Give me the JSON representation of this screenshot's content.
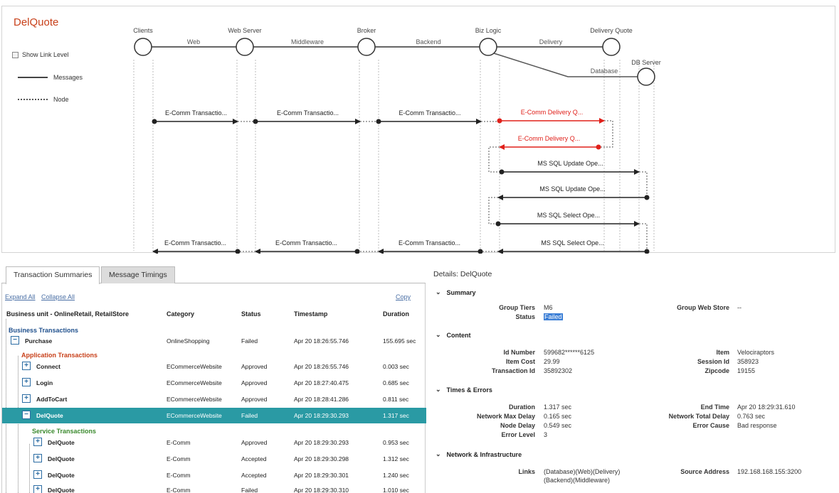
{
  "app": {
    "title": "DelQuote"
  },
  "legend": {
    "show_link_level": "Show Link Level",
    "messages": "Messages",
    "node": "Node"
  },
  "diagram": {
    "nodes": [
      {
        "label": "Clients"
      },
      {
        "label": "Web Server"
      },
      {
        "label": "Broker"
      },
      {
        "label": "Biz Logic"
      },
      {
        "label": "Delivery Quote"
      },
      {
        "label": "DB Server"
      }
    ],
    "links": [
      {
        "label": "Web"
      },
      {
        "label": "Middleware"
      },
      {
        "label": "Backend"
      },
      {
        "label": "Delivery"
      },
      {
        "label": "Database"
      }
    ],
    "messages": [
      {
        "label": "E-Comm Transactio...",
        "status": "ok"
      },
      {
        "label": "E-Comm Transactio...",
        "status": "ok"
      },
      {
        "label": "E-Comm Transactio...",
        "status": "ok"
      },
      {
        "label": "E-Comm Delivery Q...",
        "status": "error"
      },
      {
        "label": "E-Comm Delivery Q...",
        "status": "error"
      },
      {
        "label": "MS SQL Update Ope...",
        "status": "ok"
      },
      {
        "label": "MS SQL Update Ope...",
        "status": "ok"
      },
      {
        "label": "MS SQL Select Ope...",
        "status": "ok"
      },
      {
        "label": "MS SQL Select Ope...",
        "status": "ok"
      },
      {
        "label": "E-Comm Transactio...",
        "status": "ok"
      },
      {
        "label": "E-Comm Transactio...",
        "status": "ok"
      },
      {
        "label": "E-Comm Transactio...",
        "status": "ok"
      }
    ],
    "colors": {
      "ok": "#222222",
      "error": "#e0201a"
    }
  },
  "tabs": {
    "summaries": "Transaction Summaries",
    "timings": "Message Timings"
  },
  "grid": {
    "expand_all": "Expand All",
    "collapse_all": "Collapse All",
    "copy": "Copy",
    "headers": {
      "name": "Business unit - OnlineRetail, RetailStore",
      "category": "Category",
      "status": "Status",
      "timestamp": "Timestamp",
      "duration": "Duration"
    },
    "business_transactions": "Business Transactions",
    "application_transactions": "Application Transactions",
    "service_transactions": "Service Transactions",
    "rows": [
      {
        "name": "Purchase",
        "category": "OnlineShopping",
        "status": "Failed",
        "timestamp": "Apr 20 18:26:55.746",
        "duration": "155.695 sec"
      },
      {
        "name": "Connect",
        "category": "ECommerceWebsite",
        "status": "Approved",
        "timestamp": "Apr 20 18:26:55.746",
        "duration": "0.003 sec"
      },
      {
        "name": "Login",
        "category": "ECommerceWebsite",
        "status": "Approved",
        "timestamp": "Apr 20 18:27:40.475",
        "duration": "0.685 sec"
      },
      {
        "name": "AddToCart",
        "category": "ECommerceWebsite",
        "status": "Approved",
        "timestamp": "Apr 20 18:28:41.286",
        "duration": "0.811 sec"
      },
      {
        "name": "DelQuote",
        "category": "ECommerceWebsite",
        "status": "Failed",
        "timestamp": "Apr 20 18:29:30.293",
        "duration": "1.317 sec"
      },
      {
        "name": "DelQuote",
        "category": "E-Comm",
        "status": "Approved",
        "timestamp": "Apr 20 18:29:30.293",
        "duration": "0.953 sec"
      },
      {
        "name": "DelQuote",
        "category": "E-Comm",
        "status": "Accepted",
        "timestamp": "Apr 20 18:29:30.298",
        "duration": "1.312 sec"
      },
      {
        "name": "DelQuote",
        "category": "E-Comm",
        "status": "Accepted",
        "timestamp": "Apr 20 18:29:30.301",
        "duration": "1.240 sec"
      },
      {
        "name": "DelQuote",
        "category": "E-Comm",
        "status": "Failed",
        "timestamp": "Apr 20 18:29:30.310",
        "duration": "1.010 sec"
      }
    ]
  },
  "details": {
    "title": "Details: DelQuote",
    "sections": {
      "summary": "Summary",
      "content": "Content",
      "times": "Times & Errors",
      "network": "Network & Infrastructure"
    },
    "summary": {
      "group_tiers_label": "Group Tiers",
      "group_tiers": "M6",
      "status_label": "Status",
      "status": "Failed",
      "group_web_store_label": "Group Web Store",
      "group_web_store": "--"
    },
    "content": {
      "id_number_label": "Id Number",
      "id_number": "599682******6125",
      "item_cost_label": "Item Cost",
      "item_cost": "29.99",
      "transaction_id_label": "Transaction Id",
      "transaction_id": "35892302",
      "item_label": "Item",
      "item": "Velociraptors",
      "session_id_label": "Session Id",
      "session_id": "358923",
      "zipcode_label": "Zipcode",
      "zipcode": "19155"
    },
    "times": {
      "duration_label": "Duration",
      "duration": "1.317 sec",
      "net_max_delay_label": "Network Max Delay",
      "net_max_delay": "0.165 sec",
      "node_delay_label": "Node Delay",
      "node_delay": "0.549 sec",
      "error_level_label": "Error Level",
      "error_level": "3",
      "end_time_label": "End Time",
      "end_time": "Apr 20 18:29:31.610",
      "net_total_delay_label": "Network Total Delay",
      "net_total_delay": "0.763 sec",
      "error_cause_label": "Error Cause",
      "error_cause": "Bad response"
    },
    "network": {
      "links_label": "Links",
      "links_line1": "(Database)(Web)(Delivery)",
      "links_line2": "(Backend)(Middleware)",
      "source_address_label": "Source Address",
      "source_address": "192.168.168.155:3200"
    }
  }
}
